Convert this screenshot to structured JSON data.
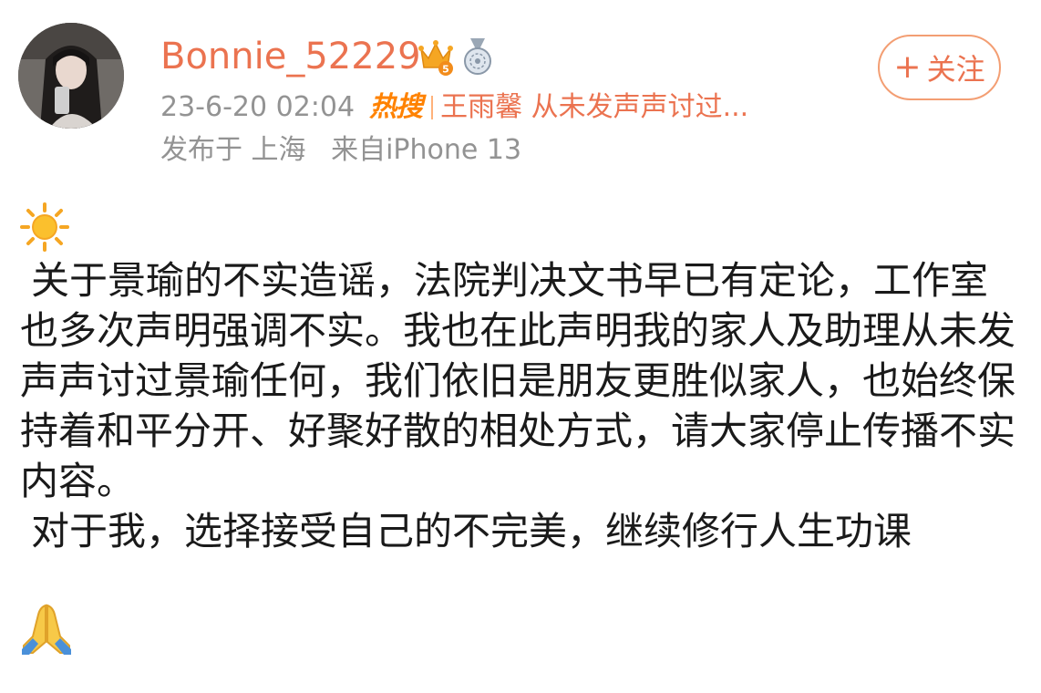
{
  "post": {
    "username": "Bonnie_52229",
    "timestamp": "23-6-20 02:04",
    "hot_tag": "热搜",
    "hot_topic": "王雨馨 从未发声声讨过...",
    "location": "发布于 上海",
    "device": "来自iPhone 13",
    "follow_plus": "+",
    "follow_label": "关注",
    "paragraph_1": "关于景瑜的不实造谣，法院判决文书早已有定论，工作室也多次声明强调不实。我也在此声明我的家人及助理从未发声声讨过景瑜任何，我们依旧是朋友更胜似家人，也始终保持着和平分开、好聚好散的相处方式，请大家停止传播不实内容。",
    "paragraph_2": "对于我，选择接受自己的不完美，继续修行人生功课"
  },
  "icons": {
    "avatar": "user-avatar",
    "crown_badge": "crown-badge-icon",
    "medal_badge": "medal-badge-icon",
    "sun": "sun-emoji-icon",
    "pray": "praying-hands-emoji-icon"
  },
  "colors": {
    "username": "#eb7350",
    "meta_text": "#939393",
    "hot_tag": "#ff8200",
    "follow_border": "#f39e73",
    "body_text": "#1a1a1a"
  }
}
